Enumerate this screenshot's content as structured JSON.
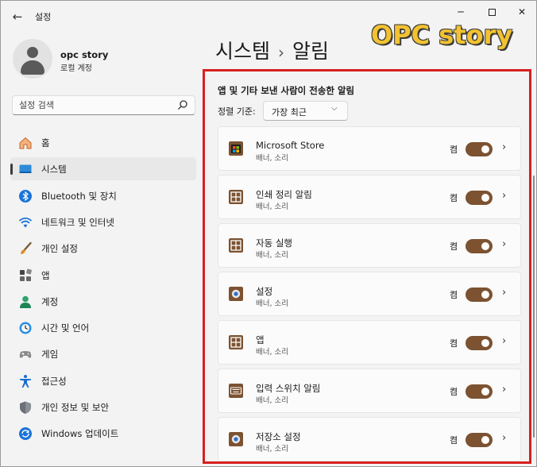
{
  "window": {
    "app_title": "설정",
    "back_icon": "arrow-left-icon",
    "controls": {
      "minimize": "─",
      "close": "✕"
    }
  },
  "profile": {
    "name": "opc story",
    "account_type": "로컬 계정"
  },
  "search": {
    "placeholder": "설정 검색"
  },
  "sidebar": {
    "items": [
      {
        "label": "홈",
        "icon": "home-icon",
        "active": false
      },
      {
        "label": "시스템",
        "icon": "system-icon",
        "active": true
      },
      {
        "label": "Bluetooth 및 장치",
        "icon": "bluetooth-icon",
        "active": false
      },
      {
        "label": "네트워크 및 인터넷",
        "icon": "wifi-icon",
        "active": false
      },
      {
        "label": "개인 설정",
        "icon": "brush-icon",
        "active": false
      },
      {
        "label": "앱",
        "icon": "apps-icon",
        "active": false
      },
      {
        "label": "계정",
        "icon": "person-icon",
        "active": false
      },
      {
        "label": "시간 및 언어",
        "icon": "clock-globe-icon",
        "active": false
      },
      {
        "label": "게임",
        "icon": "gamepad-icon",
        "active": false
      },
      {
        "label": "접근성",
        "icon": "accessibility-icon",
        "active": false
      },
      {
        "label": "개인 정보 및 보안",
        "icon": "shield-icon",
        "active": false
      },
      {
        "label": "Windows 업데이트",
        "icon": "update-icon",
        "active": false
      }
    ]
  },
  "header": {
    "crumb_parent": "시스템",
    "separator": "›",
    "crumb_current": "알림"
  },
  "watermark": "OPC story",
  "notifications": {
    "section_title": "앱 및 기타 보낸 사람이 전송한 알림",
    "sort_label": "정렬 기준:",
    "sort_value": "가장 최근",
    "apps": [
      {
        "name": "Microsoft Store",
        "sub": "배너, 소리",
        "state": "켬",
        "icon": "store-icon"
      },
      {
        "name": "인쇄 정리 알림",
        "sub": "배너, 소리",
        "state": "켬",
        "icon": "window-icon"
      },
      {
        "name": "자동 실행",
        "sub": "배너, 소리",
        "state": "켬",
        "icon": "window-icon"
      },
      {
        "name": "설정",
        "sub": "배너, 소리",
        "state": "켬",
        "icon": "settings-gear-icon"
      },
      {
        "name": "앱",
        "sub": "배너, 소리",
        "state": "켬",
        "icon": "window-icon"
      },
      {
        "name": "입력 스위치 알림",
        "sub": "배너, 소리",
        "state": "켬",
        "icon": "keyboard-icon"
      },
      {
        "name": "저장소 설정",
        "sub": "배너, 소리",
        "state": "켬",
        "icon": "settings-gear-icon"
      }
    ]
  },
  "colors": {
    "accent": "#7c5231",
    "highlight_frame": "#d81f1f",
    "watermark": "#f2c230"
  }
}
